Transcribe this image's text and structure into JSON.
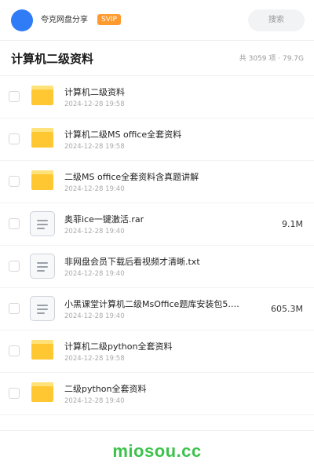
{
  "header": {
    "username": "夸克网盘分享",
    "badge": "SVIP",
    "search_placeholder": "搜索"
  },
  "folder": {
    "title": "计算机二级资料",
    "summary": "共 3059 项 · 79.7G"
  },
  "items": [
    {
      "type": "folder",
      "icon": "folder-icon",
      "name": "计算机二级资料",
      "date": "2024-12-28 19:58",
      "size": ""
    },
    {
      "type": "folder",
      "icon": "folder-icon",
      "name": "计算机二级MS office全套资料",
      "date": "2024-12-28 19:58",
      "size": ""
    },
    {
      "type": "folder",
      "icon": "folder-icon",
      "name": "二级MS office全套资料含真题讲解",
      "date": "2024-12-28 19:40",
      "size": ""
    },
    {
      "type": "file",
      "icon": "document-icon",
      "name": "奥菲ice一键激活.rar",
      "date": "2024-12-28 19:40",
      "size": "9.1M"
    },
    {
      "type": "file",
      "icon": "document-icon",
      "name": "非网盘会员下载后看视频才清晰.txt",
      "date": "2024-12-28 19:40",
      "size": ""
    },
    {
      "type": "file",
      "icon": "document-icon",
      "name": "小黑课堂计算机二级MsOffice题库安装包5.9…",
      "date": "2024-12-28 19:40",
      "size": "605.3M"
    },
    {
      "type": "folder",
      "icon": "folder-icon",
      "name": "计算机二级python全套资料",
      "date": "2024-12-28 19:58",
      "size": ""
    },
    {
      "type": "folder",
      "icon": "folder-icon",
      "name": "二级python全套资料",
      "date": "2024-12-28 19:40",
      "size": ""
    }
  ],
  "footer": {
    "watermark": "miosou.cc"
  },
  "colors": {
    "accent": "#2f7cf6",
    "badge": "#ff9a2e",
    "folder": "#ffc832",
    "watermark": "#3cc24b"
  }
}
